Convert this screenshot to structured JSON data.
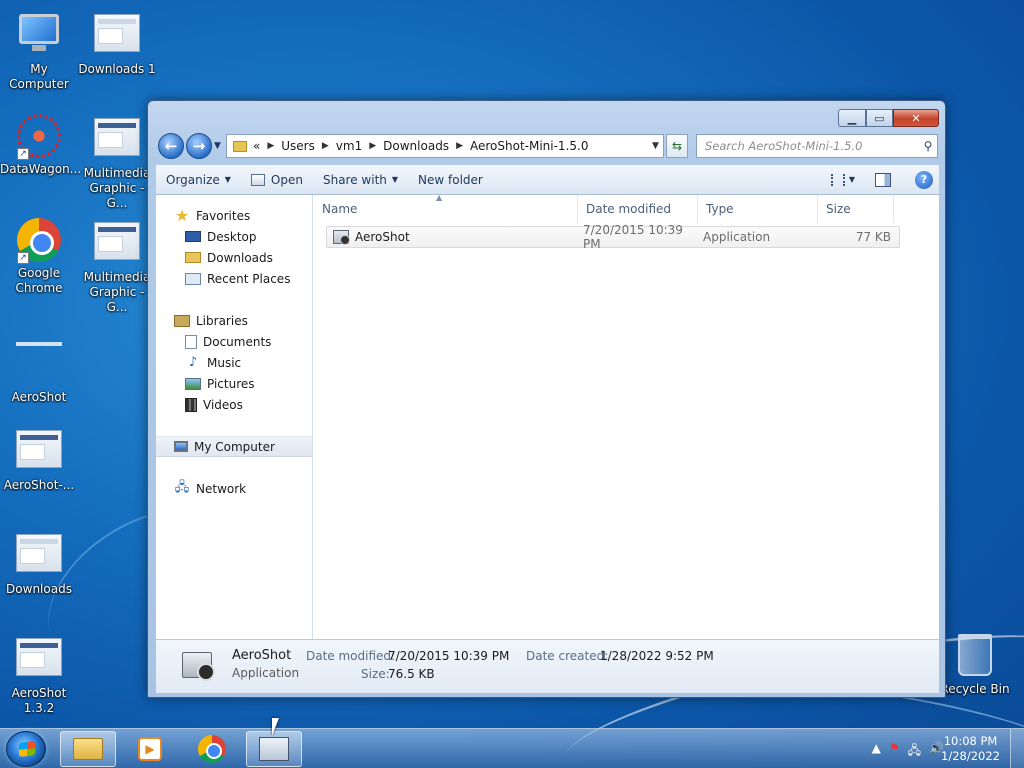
{
  "desktop": {
    "icons": [
      {
        "label": "My Computer",
        "icon": "my-computer-icon"
      },
      {
        "label": "Downloads 1",
        "icon": "folder-thumbnail-icon"
      },
      {
        "label": "DataWagon...",
        "icon": "datawagon-icon"
      },
      {
        "label": "Multimedia Graphic - G...",
        "icon": "screenshot-thumbnail-icon"
      },
      {
        "label": "Google Chrome",
        "icon": "chrome-icon"
      },
      {
        "label": "Multimedia Graphic - G...",
        "icon": "screenshot-thumbnail-icon"
      },
      {
        "label": "AeroShot",
        "icon": "aeroshot-icon"
      },
      {
        "label": "AeroShot-...",
        "icon": "screenshot-thumbnail-icon"
      },
      {
        "label": "Downloads",
        "icon": "folder-thumbnail-icon"
      },
      {
        "label": "AeroShot 1.3.2",
        "icon": "screenshot-thumbnail-icon"
      },
      {
        "label": "Recycle Bin",
        "icon": "recycle-bin-icon"
      }
    ]
  },
  "explorer": {
    "breadcrumb": [
      "«",
      "Users",
      "vm1",
      "Downloads",
      "AeroShot-Mini-1.5.0"
    ],
    "search_placeholder": "Search AeroShot-Mini-1.5.0",
    "toolbar": {
      "organize": "Organize",
      "open": "Open",
      "share_with": "Share with",
      "new_folder": "New folder"
    },
    "nav": {
      "favorites": "Favorites",
      "desktop": "Desktop",
      "downloads": "Downloads",
      "recent_places": "Recent Places",
      "libraries": "Libraries",
      "documents": "Documents",
      "music": "Music",
      "pictures": "Pictures",
      "videos": "Videos",
      "my_computer": "My Computer",
      "network": "Network"
    },
    "columns": {
      "name": "Name",
      "date_modified": "Date modified",
      "type": "Type",
      "size": "Size"
    },
    "files": [
      {
        "name": "AeroShot",
        "date_modified": "7/20/2015 10:39 PM",
        "type": "Application",
        "size": "77 KB"
      }
    ],
    "details": {
      "name": "AeroShot",
      "type": "Application",
      "date_modified_label": "Date modified:",
      "date_modified": "7/20/2015 10:39 PM",
      "date_created_label": "Date created:",
      "date_created": "1/28/2022 9:52 PM",
      "size_label": "Size:",
      "size": "76.5 KB"
    }
  },
  "taskbar": {
    "time": "10:08 PM",
    "date": "1/28/2022"
  }
}
